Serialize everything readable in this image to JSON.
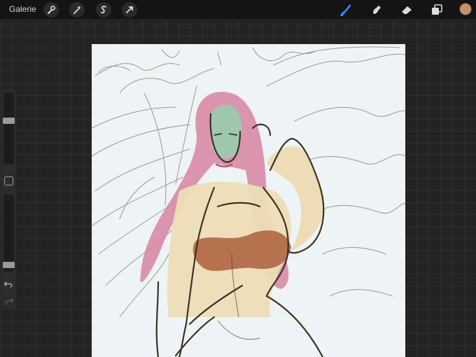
{
  "topbar": {
    "gallery_label": "Galerie",
    "left_tools": [
      "wrench-icon",
      "magic-wand-icon",
      "selection-s-icon",
      "transform-arrow-icon"
    ],
    "right_tools": [
      "brush-icon",
      "smudge-icon",
      "eraser-icon",
      "layers-icon"
    ],
    "active_tool": "brush-icon",
    "current_color": "#c8916a"
  },
  "sidebar": {
    "brush_size_level": 0.62,
    "opacity_level": 0.05,
    "controls": [
      "brush-size-slider",
      "modify-button",
      "opacity-slider",
      "undo-button",
      "redo-button"
    ]
  },
  "canvas": {
    "background_color": "#eef3f5",
    "hair_color": "#d88aa6",
    "skin_color": "#eddcb6",
    "face_color": "#9fc7ae",
    "top_color": "#b6724f",
    "line_color": "#3a3323"
  }
}
